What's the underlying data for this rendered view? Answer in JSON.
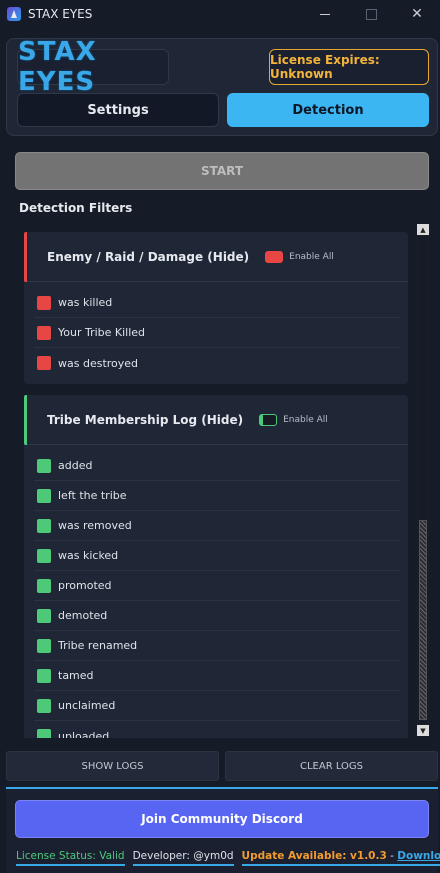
{
  "window": {
    "title": "STAX EYES",
    "controls": [
      "minimize",
      "maximize",
      "close"
    ]
  },
  "header": {
    "logo_text": "STAX EYES",
    "license_text": "License Expires: Unknown",
    "tabs": [
      {
        "label": "Settings",
        "active": false
      },
      {
        "label": "Detection",
        "active": true
      }
    ]
  },
  "controls": {
    "start_label": "START"
  },
  "filters": {
    "section_title": "Detection Filters",
    "groups": [
      {
        "title": "Enemy / Raid / Damage (Hide)",
        "enable_label": "Enable All",
        "enable_all": true,
        "accent_color": "#e84545",
        "items": [
          "was killed",
          "Your Tribe Killed",
          "was destroyed"
        ]
      },
      {
        "title": "Tribe Membership Log (Hide)",
        "enable_label": "Enable All",
        "enable_all": false,
        "accent_color": "#4ec97a",
        "items": [
          "added",
          "left the tribe",
          "was removed",
          "was kicked",
          "promoted",
          "demoted",
          "Tribe renamed",
          "tamed",
          "unclaimed",
          "uploaded"
        ]
      }
    ]
  },
  "bottom": {
    "show_logs_label": "SHOW LOGS",
    "clear_logs_label": "CLEAR LOGS",
    "discord_label": "Join Community Discord"
  },
  "status": {
    "license_status": "License Status: Valid",
    "developer": "Developer: @ym0d",
    "update_text": "Update Available: v1.0.3",
    "separator": " - ",
    "download_label": "Download"
  },
  "colors": {
    "accent_blue": "#3bb6f2",
    "license_orange": "#f3b43a",
    "discord": "#5865f2",
    "red": "#e84545",
    "green": "#4ec97a"
  }
}
